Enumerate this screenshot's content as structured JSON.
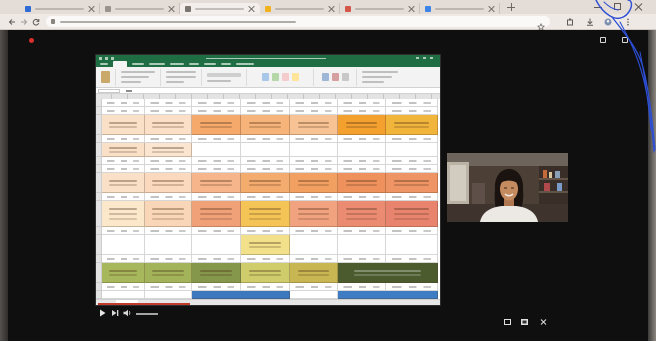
{
  "browser": {
    "tabs": [
      {
        "favicon": "meet-icon",
        "favicon_color": "#2f6bd6",
        "active": false
      },
      {
        "favicon": "page-icon",
        "favicon_color": "#9a938d",
        "active": false
      },
      {
        "favicon": "page-icon",
        "favicon_color": "#7b746f",
        "active": true
      },
      {
        "favicon": "slides-icon",
        "favicon_color": "#f1b21e",
        "active": false
      },
      {
        "favicon": "page-icon",
        "favicon_color": "#d4574a",
        "active": false
      },
      {
        "favicon": "docs-icon",
        "favicon_color": "#3d84e8",
        "active": false
      }
    ],
    "toolbar_icons": [
      "back-icon",
      "forward-icon",
      "reload-icon",
      "lock-icon",
      "star-icon",
      "extension-icon",
      "download-icon",
      "profile-icon",
      "menu-icon"
    ]
  },
  "colors": {
    "excel_green": "#1f6e43",
    "stage": "#0f0f0f",
    "recording_dot": "#d8302c",
    "pen_ink": "#2d4fd6",
    "sheet_tab_accent": "#c23a2b"
  },
  "spreadsheet": {
    "rows": [
      {
        "kind": "num"
      },
      {
        "kind": "num"
      },
      {
        "kind": "label",
        "cells": [
          "#fbe0c8",
          "#fbdfc7",
          "#f5aa6c",
          "#f6b47a",
          "#f7c294",
          "#f4a02e",
          "#f2b53c"
        ]
      },
      {
        "kind": "num"
      },
      {
        "kind": "short",
        "cells": [
          "#fbe0c8",
          "#fbe4d0",
          null,
          null,
          null,
          null,
          null
        ]
      },
      {
        "kind": "num"
      },
      {
        "kind": "num"
      },
      {
        "kind": "label",
        "cells": [
          "#fbe0c8",
          "#fad9bf",
          "#f6b58a",
          "#f4ab6e",
          "#f2a062",
          "#ef915d",
          "#ee9465"
        ]
      },
      {
        "kind": "num"
      },
      {
        "kind": "tall",
        "cells": [
          "#fbe7c9",
          "#f9d6b7",
          "#f1a178",
          "#f4c556",
          "#f1a27e",
          "#eb8c72",
          "#e8846e"
        ]
      },
      {
        "kind": "num"
      },
      {
        "kind": "label",
        "cells": [
          null,
          null,
          null,
          "#f2e08a",
          null,
          null,
          null
        ]
      },
      {
        "kind": "num"
      },
      {
        "kind": "label",
        "cells": [
          "#a7b75c",
          "#a2b35a",
          "#84974a",
          "#cfcc6c",
          "#c8b653",
          {
            "fill": "#4b5b2d",
            "span": 2
          }
        ]
      },
      {
        "kind": "num"
      },
      {
        "kind": "band",
        "cells": [
          null,
          null,
          {
            "fill": "#3d78bf",
            "span": 2
          },
          null,
          {
            "fill": "#3e7cc3",
            "span": 2
          }
        ]
      }
    ]
  },
  "player_controls": [
    "play-icon",
    "next-icon",
    "volume-icon"
  ],
  "stage_controls": [
    "layout-icon",
    "fullscreen-icon",
    "tile-icon",
    "grid-icon",
    "more-icon"
  ]
}
